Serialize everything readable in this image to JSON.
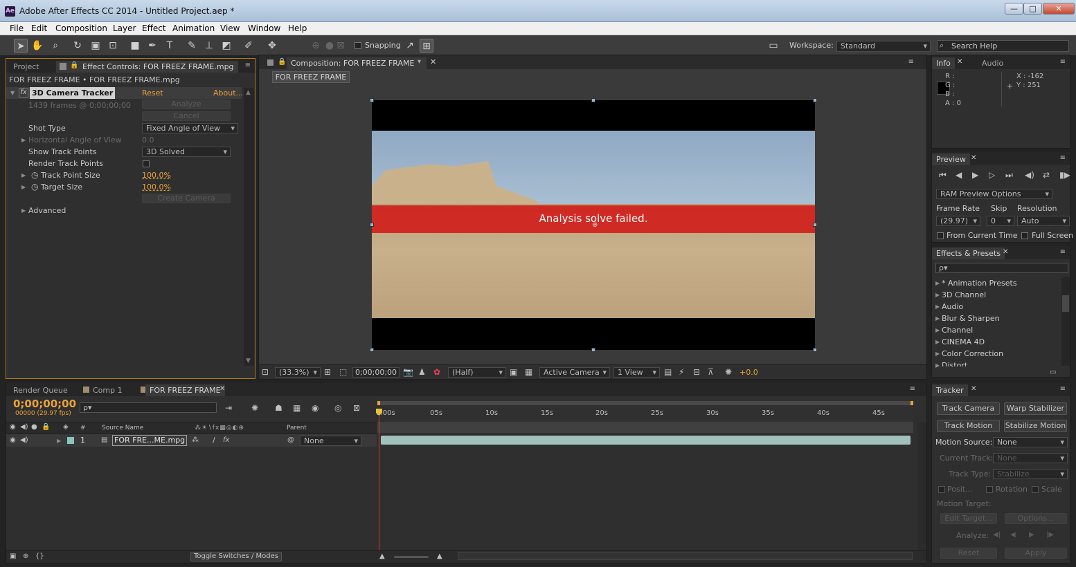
{
  "window": {
    "title": "Adobe After Effects CC 2014 - Untitled Project.aep *",
    "app_icon": "Ae",
    "minimize": "—",
    "maximize": "□",
    "close": "✕"
  },
  "menu": [
    "File",
    "Edit",
    "Composition",
    "Layer",
    "Effect",
    "Animation",
    "View",
    "Window",
    "Help"
  ],
  "toolbar": {
    "snapping": "Snapping",
    "workspace_label": "Workspace:",
    "workspace": "Standard",
    "search_placeholder": "Search Help"
  },
  "left_panel": {
    "tab_project": "Project",
    "tab_effect": "Effect Controls: FOR FREEZ FRAME.mpg",
    "breadcrumb": "FOR FREEZ FRAME • FOR FREEZ FRAME.mpg",
    "effect_name": "3D Camera Tracker",
    "reset": "Reset",
    "about": "About...",
    "frames": "1439 frames @ 0;00;00;00",
    "analyze": "Analyze",
    "cancel": "Cancel",
    "shot_type_label": "Shot Type",
    "shot_type": "Fixed Angle of View",
    "haov_label": "Horizontal Angle of View",
    "haov": "0.0",
    "show_track_label": "Show Track Points",
    "show_track": "3D Solved",
    "render_track_label": "Render Track Points",
    "track_size_label": "Track Point Size",
    "track_size": "100.0%",
    "target_size_label": "Target Size",
    "target_size": "100.0%",
    "create_camera": "Create Camera",
    "advanced": "Advanced"
  },
  "comp_panel": {
    "tab": "Composition: FOR FREEZ FRAME",
    "subtab": "FOR FREEZ FRAME",
    "message": "Analysis solve failed.",
    "zoom": "(33.3%)",
    "timecode": "0;00;00;00",
    "resolution": "(Half)",
    "camera": "Active Camera",
    "views": "1 View",
    "exposure": "+0.0"
  },
  "info": {
    "tab_info": "Info",
    "tab_audio": "Audio",
    "r": "R :",
    "g": "G :",
    "b": "B :",
    "a": "A : 0",
    "x": "X : -162",
    "y": "Y : 251"
  },
  "preview": {
    "tab": "Preview",
    "ram": "RAM Preview Options",
    "frame_rate_label": "Frame Rate",
    "skip_label": "Skip",
    "resolution_label": "Resolution",
    "frame_rate": "(29.97)",
    "skip": "0",
    "resolution": "Auto",
    "from_current": "From Current Time",
    "full_screen": "Full Screen"
  },
  "effects": {
    "tab": "Effects & Presets",
    "search_placeholder": "ρ▾",
    "items": [
      "* Animation Presets",
      "3D Channel",
      "Audio",
      "Blur & Sharpen",
      "Channel",
      "CINEMA 4D",
      "Color Correction",
      "Distort"
    ]
  },
  "timeline": {
    "tab_render": "Render Queue",
    "tab_comp1": "Comp 1",
    "tab_active": "FOR FREEZ FRAME",
    "timecode": "0;00;00;00",
    "fps": "00000 (29.97 fps)",
    "search_placeholder": "ρ▾",
    "col_num": "#",
    "col_source": "Source Name",
    "col_parent": "Parent",
    "layer_num": "1",
    "layer_name": "FOR FRE...ME.mpg",
    "layer_parent": "None",
    "ruler": [
      "0:00s",
      "05s",
      "10s",
      "15s",
      "20s",
      "25s",
      "30s",
      "35s",
      "40s",
      "45s"
    ],
    "toggle": "Toggle Switches / Modes"
  },
  "tracker": {
    "tab": "Tracker",
    "track_camera": "Track Camera",
    "warp": "Warp Stabilizer",
    "track_motion": "Track Motion",
    "stabilize": "Stabilize Motion",
    "motion_source_label": "Motion Source:",
    "motion_source": "None",
    "current_track_label": "Current Track:",
    "current_track": "None",
    "track_type_label": "Track Type:",
    "track_type": "Stabilize",
    "position": "Posit...",
    "rotation": "Rotation",
    "scale": "Scale",
    "motion_target": "Motion Target:",
    "edit_target": "Edit Target...",
    "options": "Options...",
    "analyze_label": "Analyze:",
    "reset": "Reset",
    "apply": "Apply"
  }
}
